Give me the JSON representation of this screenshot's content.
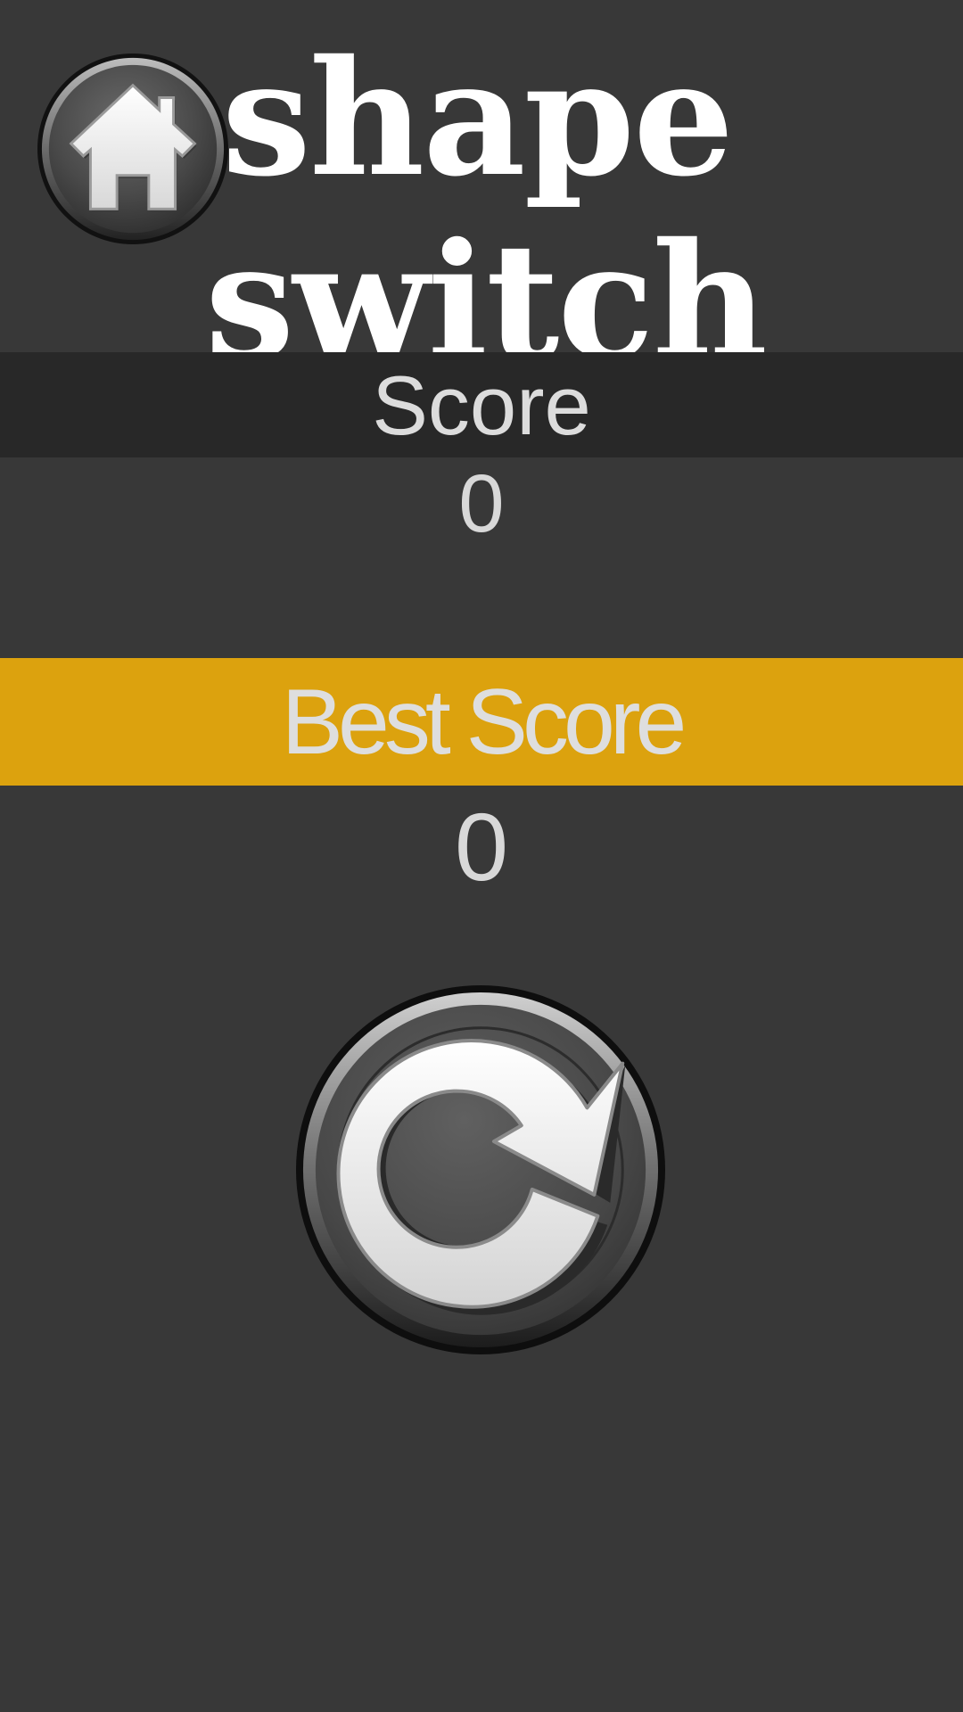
{
  "game": {
    "title_line1": "shape",
    "title_line2": "switch"
  },
  "score": {
    "label": "Score",
    "value": "0"
  },
  "best_score": {
    "label": "Best Score",
    "value": "0"
  },
  "buttons": {
    "home_icon": "home-icon",
    "replay_icon": "replay-icon"
  },
  "colors": {
    "background": "#383838",
    "score_band": "#282828",
    "best_band": "#dca20e",
    "text": "#dcdcdc"
  }
}
